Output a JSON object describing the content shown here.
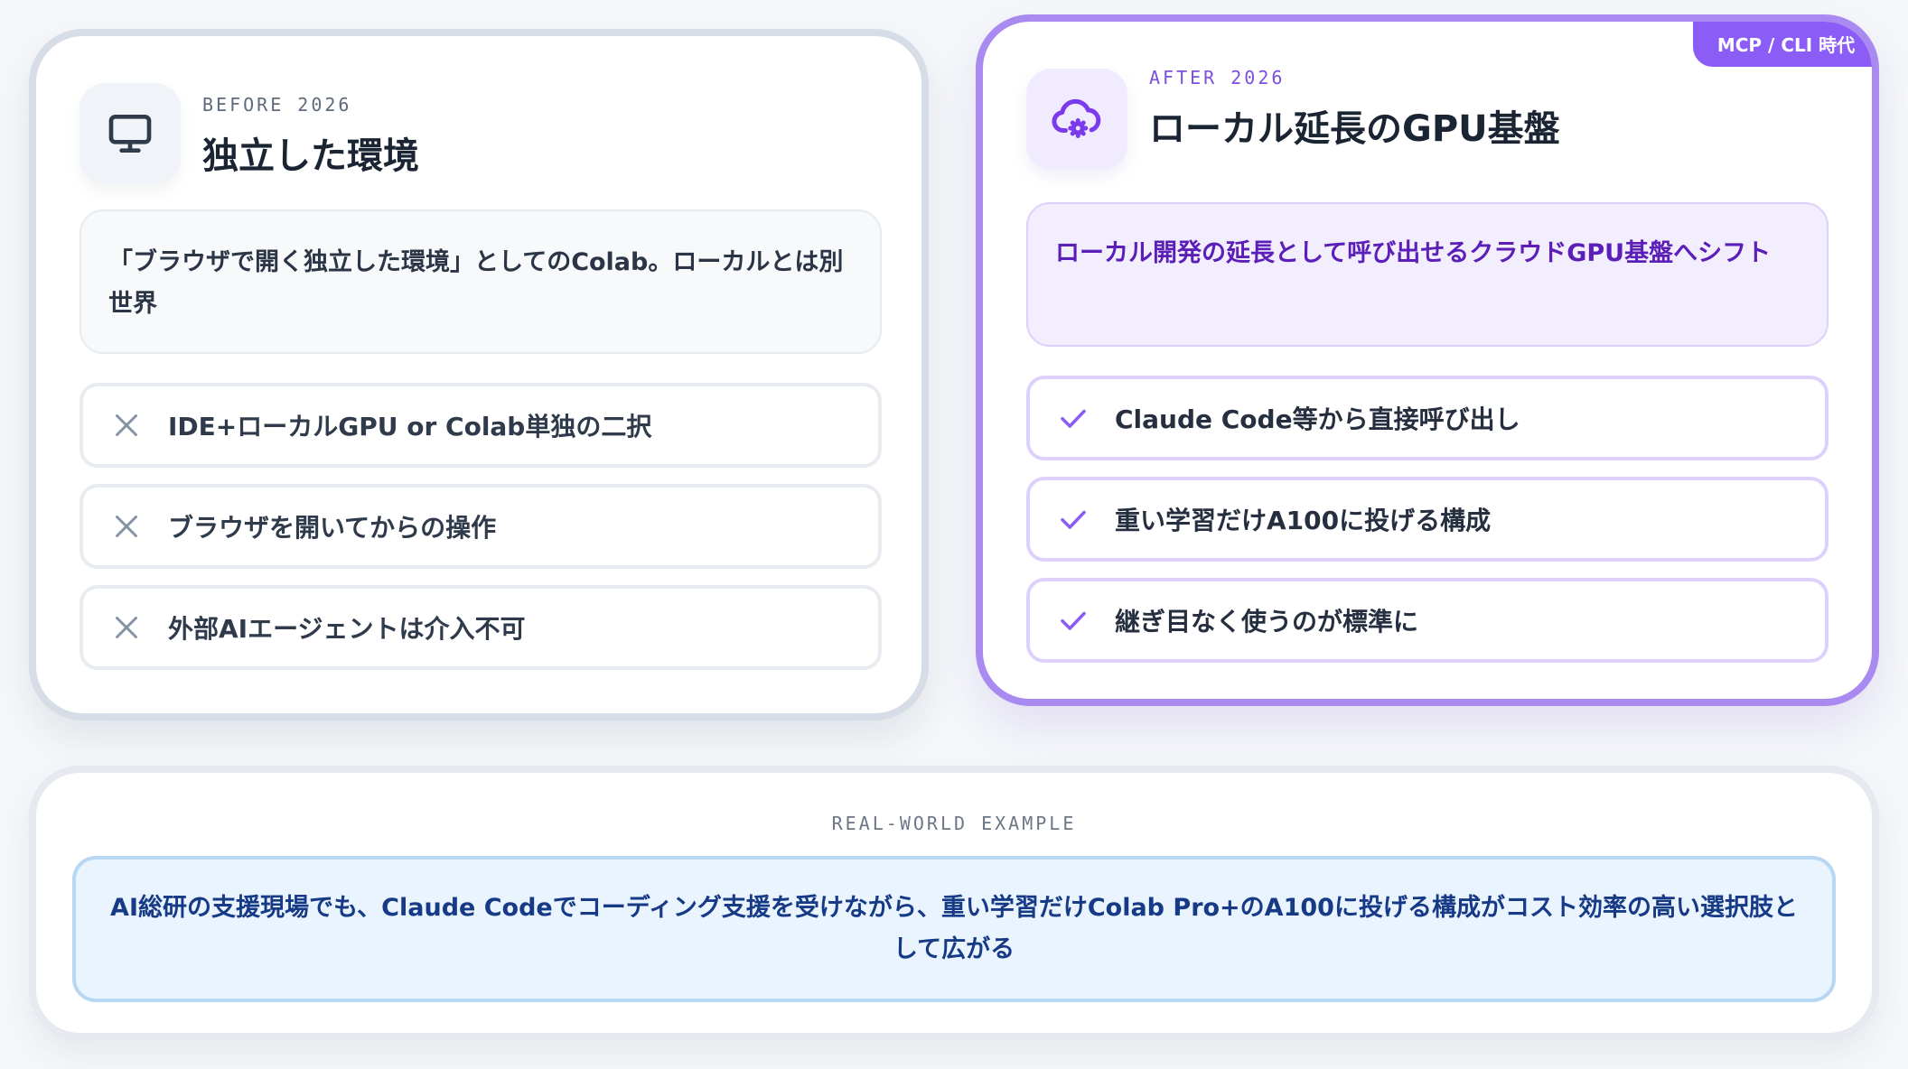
{
  "before": {
    "eyebrow": "BEFORE 2026",
    "title": "独立した環境",
    "icon": "monitor-icon",
    "description": "「ブラウザで開く独立した環境」としてのColab。ローカルとは別世界",
    "items": [
      {
        "icon": "x-icon",
        "label": "IDE+ローカルGPU or Colab単独の二択"
      },
      {
        "icon": "x-icon",
        "label": "ブラウザを開いてからの操作"
      },
      {
        "icon": "x-icon",
        "label": "外部AIエージェントは介入不可"
      }
    ]
  },
  "after": {
    "badge": "MCP / CLI 時代",
    "eyebrow": "AFTER 2026",
    "title": "ローカル延長のGPU基盤",
    "icon": "cloud-gear-icon",
    "description": "ローカル開発の延長として呼び出せるクラウドGPU基盤へシフト",
    "items": [
      {
        "icon": "check-icon",
        "label": "Claude Code等から直接呼び出し"
      },
      {
        "icon": "check-icon",
        "label": "重い学習だけA100に投げる構成"
      },
      {
        "icon": "check-icon",
        "label": "継ぎ目なく使うのが標準に"
      }
    ]
  },
  "example": {
    "label": "REAL-WORLD EXAMPLE",
    "text": "AI総研の支援現場でも、Claude Codeでコーディング支援を受けながら、重い学習だけColab Pro+のA100に投げる構成がコスト効率の高い選択肢として広がる"
  },
  "colors": {
    "before_border": "#d6dde6",
    "after_border": "#a98af0",
    "accent_purple": "#8b5cf6",
    "example_text": "#173a86"
  }
}
